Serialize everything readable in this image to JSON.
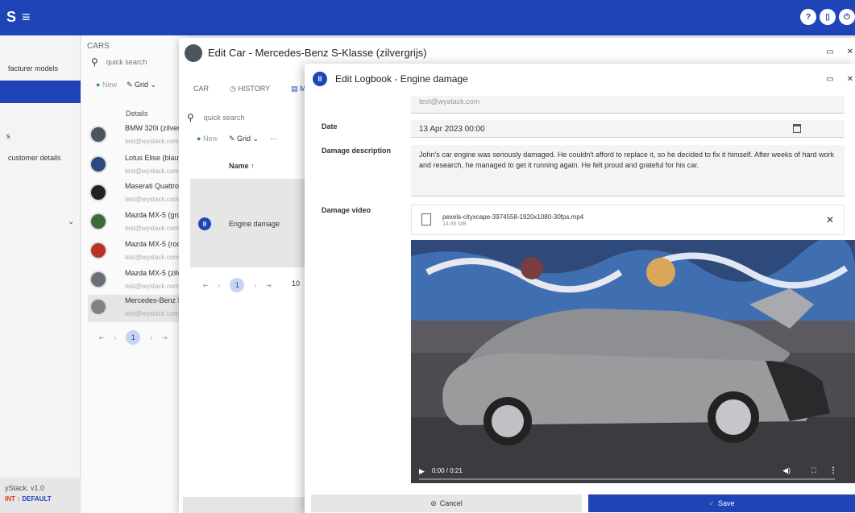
{
  "app": {
    "title": "S",
    "menu_icon": "hamburger-icon"
  },
  "topbar": {
    "icons": [
      "help-icon",
      "tablet-icon",
      "power-icon"
    ],
    "icon_glyphs": [
      "?",
      "▯",
      "⏻"
    ]
  },
  "sidebar": {
    "items": [
      {
        "label": "facturer models"
      },
      {
        "label": "s"
      },
      {
        "label": "customer details"
      }
    ],
    "version": "yStack. v1.0",
    "env_prefix": "INT ↑",
    "env_label": "DEFAULT"
  },
  "cars_panel": {
    "title": "CARS",
    "search_placeholder": "quick search",
    "new_label": "New",
    "grid_label": "Grid",
    "column_header": "Details",
    "cars": [
      {
        "name": "BMW 320i (zilver",
        "email": "test@wystack.com"
      },
      {
        "name": "Lotus Elise (blauw",
        "email": "test@wystack.com"
      },
      {
        "name": "Maserati Quattrop",
        "email": "test@wystack.com"
      },
      {
        "name": "Mazda MX-5 (gro",
        "email": "test@wystack.com"
      },
      {
        "name": "Mazda MX-5 (roo",
        "email": "test@wystack.com"
      },
      {
        "name": "Mazda MX-5 (zilv",
        "email": "test@wystack.com"
      },
      {
        "name": "Mercedes-Benz S",
        "email": "test@wystack.com"
      }
    ],
    "page": "1"
  },
  "edit_car": {
    "title": "Edit Car - Mercedes-Benz S-Klasse (zilvergrijs)",
    "tabs": [
      "CAR",
      "◷ HISTORY",
      "▤ MA"
    ],
    "search_placeholder": "quick search",
    "new_label": "New",
    "grid_label": "Grid",
    "more_label": "···",
    "column_header": "Name ↑",
    "logbook_row": {
      "name": "Engine damage"
    },
    "page": "1",
    "page_size": "10"
  },
  "edit_logbook": {
    "title": "Edit Logbook - Engine damage",
    "email_value": "test@wystack.com",
    "date_label": "Date",
    "date_value": "13 Apr 2023 00:00",
    "description_label": "Damage description",
    "description_value": "John's car engine was seriously damaged. He couldn't afford to replace it, so he decided to fix it himself. After weeks of hard work and research, he managed to get it running again. He felt proud and grateful for his car.",
    "video_label": "Damage video",
    "video_file_name": "pexels-cityxcape-3974558-1920x1080-30fps.mp4",
    "video_file_size": "14.66 MB",
    "video_time": "0:00 / 0:21",
    "cancel_label": "Cancel",
    "save_label": "Save"
  },
  "colors": {
    "primary": "#1e44b8",
    "success": "#2a9c3a",
    "env_red": "#d32222"
  }
}
